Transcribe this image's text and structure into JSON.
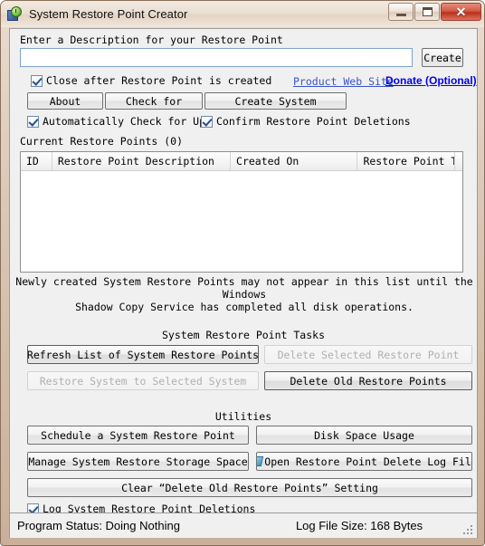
{
  "window": {
    "title": "System Restore Point Creator",
    "icon": "restore-clock-icon",
    "minimize_label": "–",
    "maximize_label": "□",
    "close_label": "✕"
  },
  "create_section": {
    "prompt": "Enter a Description for your Restore Point",
    "input_value": "",
    "input_placeholder": "",
    "create_button": "Create",
    "close_after_checkbox": "Close after Restore Point is created",
    "close_after_checked": true,
    "product_web_site_link": "Product Web Site",
    "donate_link": "Donate (Optional)"
  },
  "action_buttons": {
    "about": "About",
    "check_for": "Check for",
    "create_system": "Create System"
  },
  "option_checkboxes": {
    "auto_check_updates": "Automatically Check for Updat",
    "auto_check_updates_checked": true,
    "confirm_deletions": "Confirm Restore Point Deletions",
    "confirm_deletions_checked": true
  },
  "restore_list": {
    "heading": "Current Restore Points (0)",
    "columns": [
      "ID",
      "Restore Point Description",
      "Created On",
      "Restore Point Type"
    ],
    "rows": [],
    "note_line1": "Newly created System Restore Points may not appear in this list until the Windows",
    "note_line2": "Shadow Copy Service has completed all disk operations."
  },
  "tasks": {
    "heading": "System Restore Point Tasks",
    "refresh_list": "Refresh List of System Restore Points",
    "delete_selected": "Delete Selected Restore Point",
    "delete_selected_disabled": true,
    "restore_system": "Restore System to Selected System",
    "restore_system_disabled": true,
    "delete_old": "Delete Old Restore Points"
  },
  "utilities": {
    "heading": "Utilities",
    "schedule": "Schedule a System Restore Point",
    "disk_space": "Disk Space Usage",
    "manage_storage": "Manage System Restore Storage Space",
    "open_log": "Open Restore Point Delete Log File",
    "open_log_icon": "log-file-icon",
    "clear_setting": "Clear “Delete Old Restore Points” Setting",
    "log_deletions_checkbox": "Log System Restore Point Deletions",
    "log_deletions_checked": true
  },
  "statusbar": {
    "program_status": "Program Status:  Doing Nothing",
    "log_file_size": "Log File Size:  168 Bytes"
  }
}
